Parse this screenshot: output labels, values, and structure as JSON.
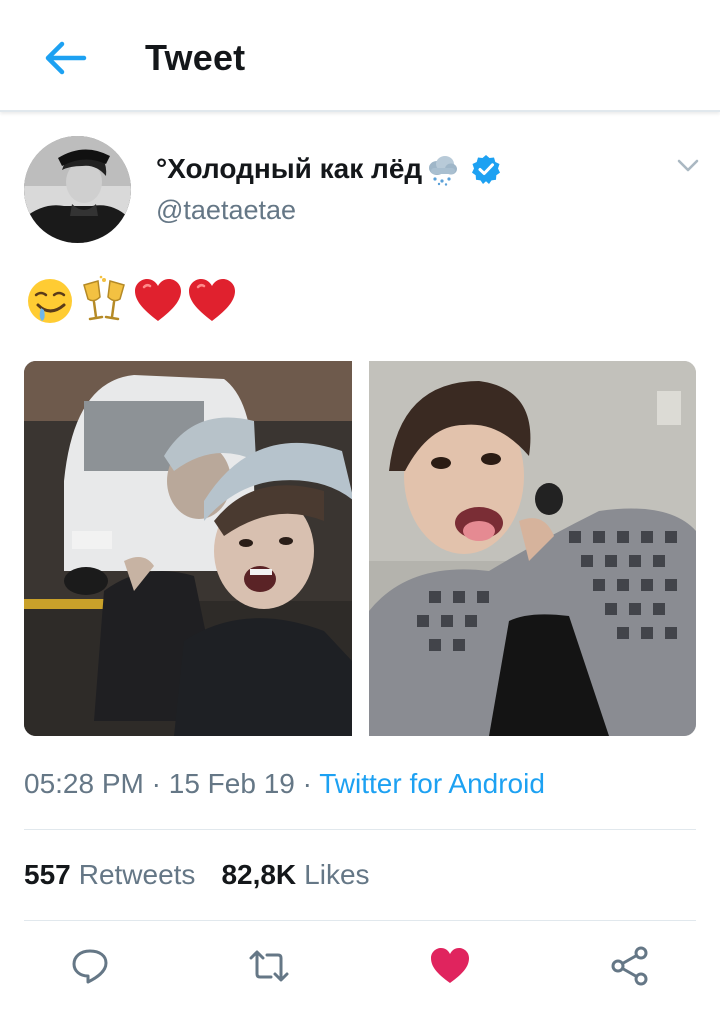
{
  "header": {
    "title": "Tweet",
    "back_icon": "arrow-left-icon",
    "accent": "#1da1f2"
  },
  "tweet": {
    "display_name": "°Холодный как лёд",
    "name_icons": [
      "cloud-snow-emoji",
      "verified-badge-icon"
    ],
    "handle": "@taetaetae",
    "emoji_text": [
      "drooling-face-emoji",
      "clinking-glasses-emoji",
      "red-heart-emoji",
      "red-heart-emoji"
    ],
    "media_count": 2,
    "time": "05:28 PM",
    "date": "15 Feb 19",
    "separator": "·",
    "source": "Twitter for Android"
  },
  "stats": {
    "retweets_count": "557",
    "retweets_label": "Retweets",
    "likes_count": "82,8K",
    "likes_label": "Likes"
  },
  "actions": {
    "reply_icon": "reply-icon",
    "retweet_icon": "retweet-icon",
    "like_icon": "heart-icon",
    "share_icon": "share-icon",
    "liked": true,
    "like_color": "#e0245e"
  },
  "colors": {
    "text_primary": "#14171a",
    "text_secondary": "#657786",
    "divider": "#e1e8ed"
  }
}
